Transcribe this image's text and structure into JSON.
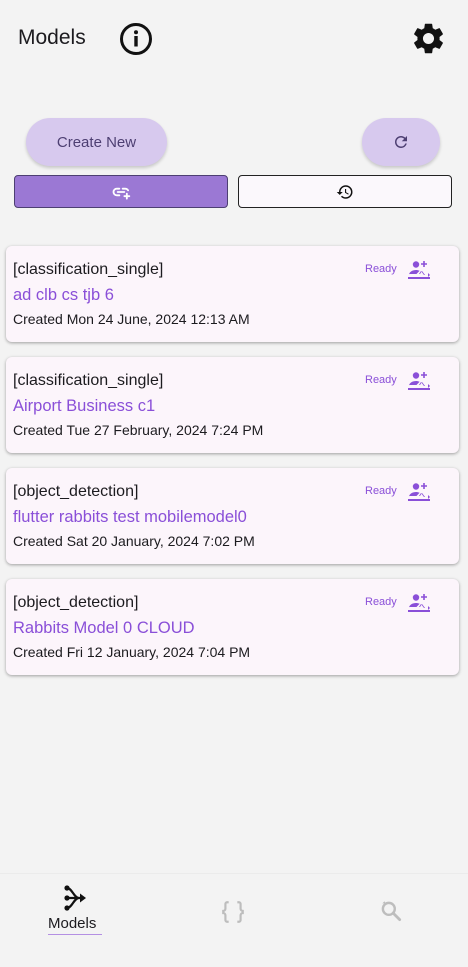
{
  "header": {
    "title": "Models"
  },
  "actions": {
    "create_label": "Create New"
  },
  "models": [
    {
      "type": "[classification_single]",
      "name": "ad clb cs tjb 6",
      "created": "Created Mon 24 June, 2024 12:13 AM",
      "status": "Ready"
    },
    {
      "type": "[classification_single]",
      "name": "Airport Business c1",
      "created": "Created Tue 27 February, 2024 7:24 PM",
      "status": "Ready"
    },
    {
      "type": "[object_detection]",
      "name": "flutter rabbits test mobilemodel0",
      "created": "Created Sat 20 January, 2024 7:02 PM",
      "status": "Ready"
    },
    {
      "type": "[object_detection]",
      "name": "Rabbits Model 0 CLOUD",
      "created": "Created Fri 12 January, 2024 7:04 PM",
      "status": "Ready"
    }
  ],
  "nav": {
    "models_label": "Models"
  },
  "icons": {
    "info": "info-icon",
    "settings": "gear-icon",
    "refresh": "refresh-icon",
    "link": "add-link-icon",
    "history": "history-icon",
    "model_status": "model-training-icon",
    "models_nav": "account-tree-icon",
    "code_nav": "data-object-icon",
    "search_nav": "image-search-icon"
  },
  "colors": {
    "accent": "#8a4fd8",
    "button_bg": "#d7c9ee",
    "segment_active": "#9b78d4",
    "card_bg": "#fcf5fb"
  }
}
